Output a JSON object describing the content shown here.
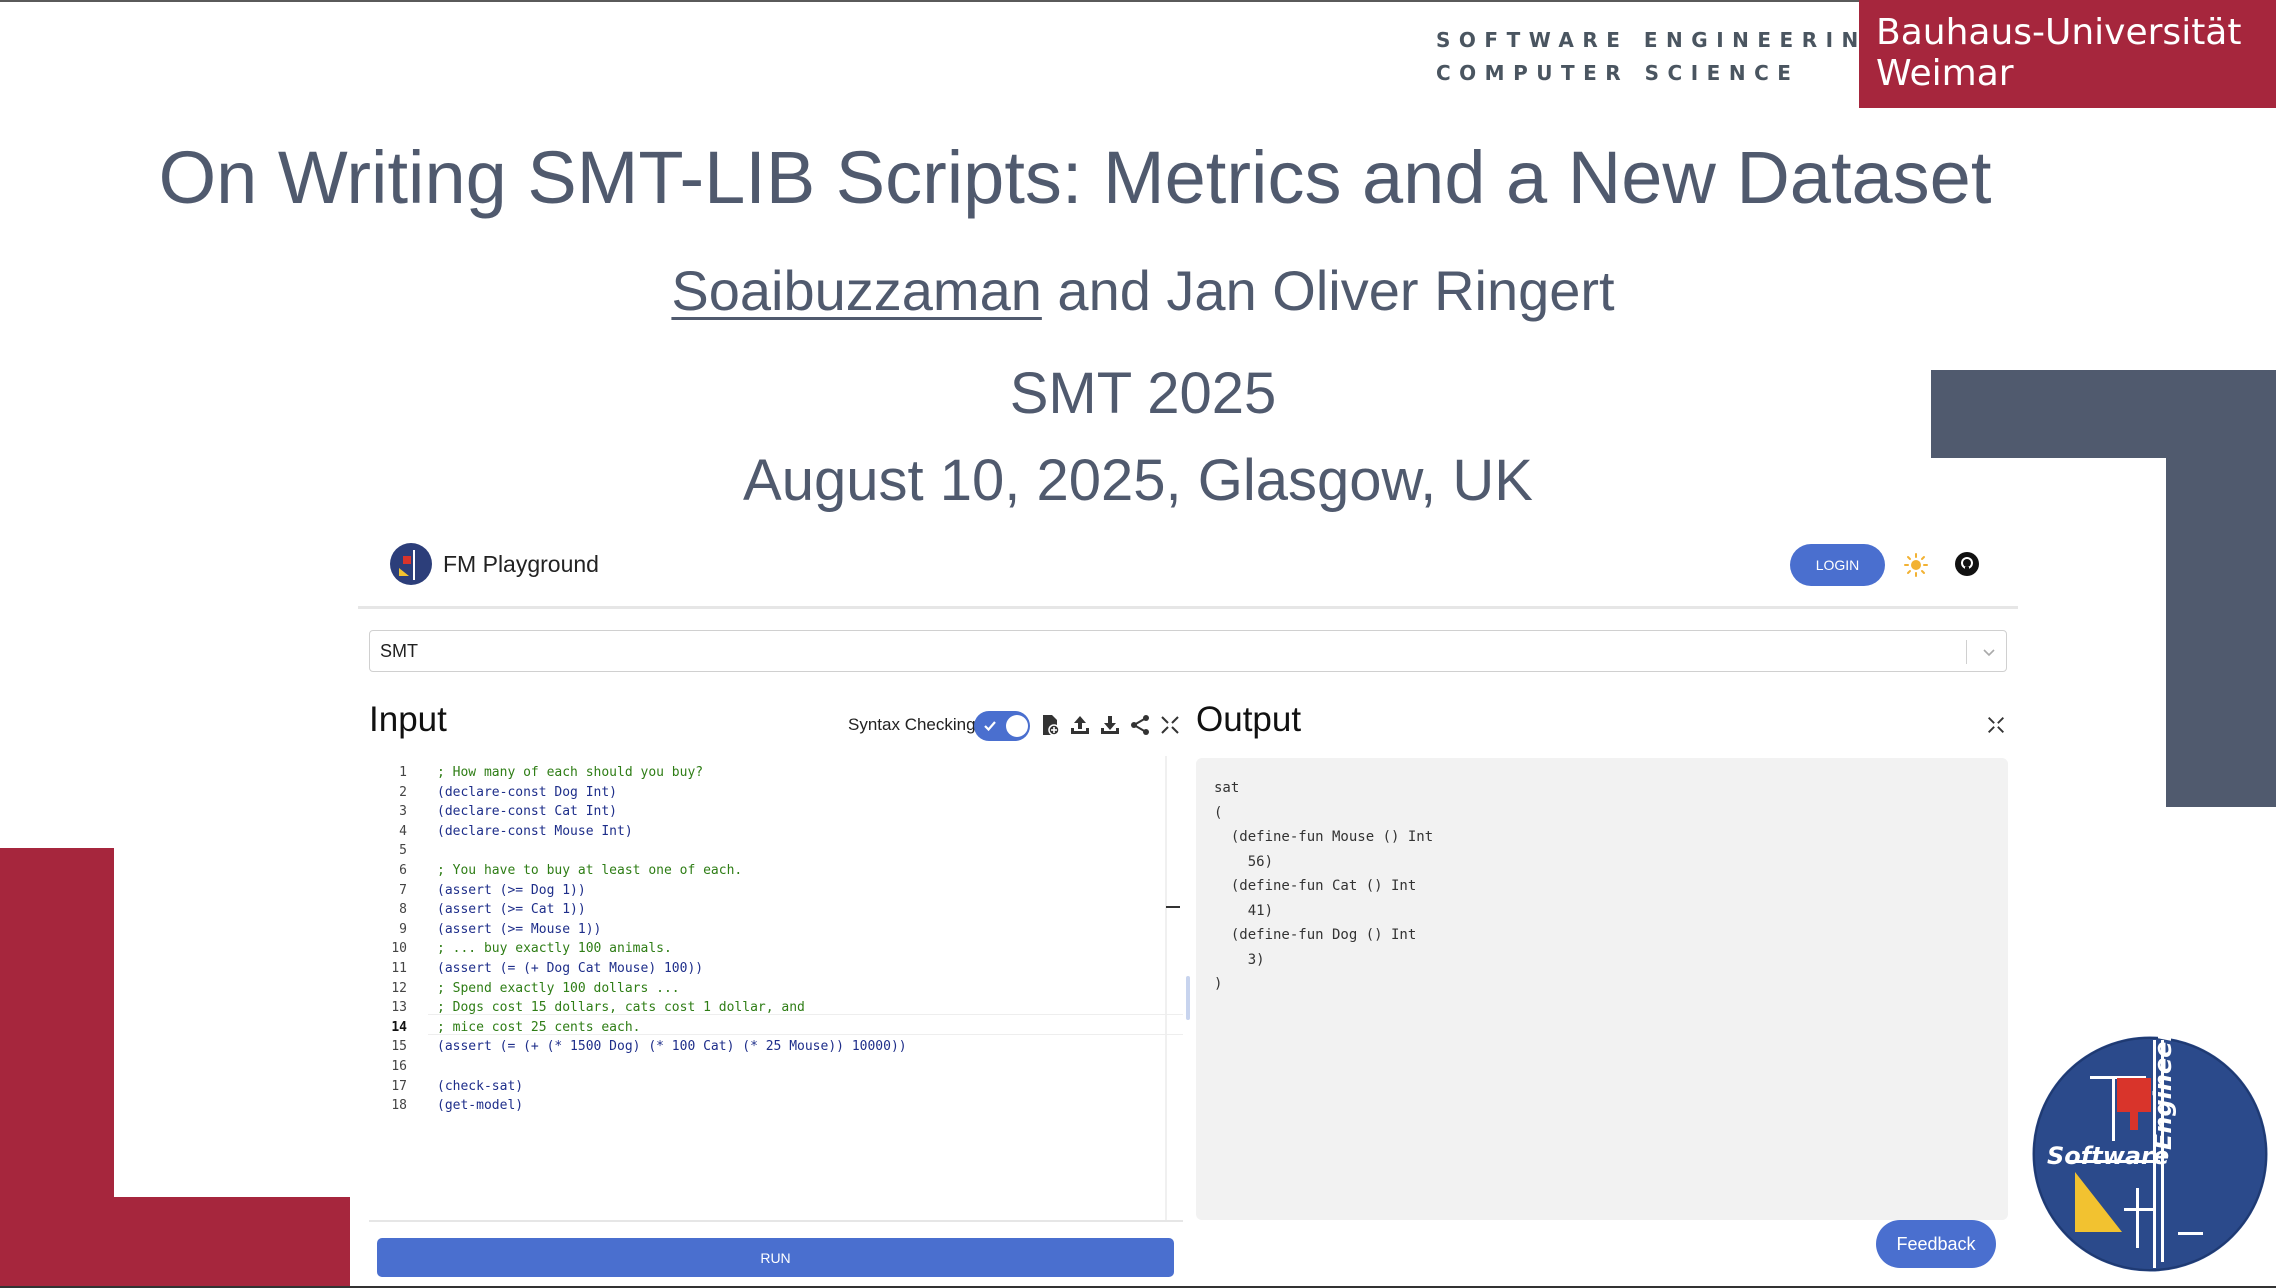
{
  "header": {
    "department_line1": "SOFTWARE ENGINEERING",
    "department_line2": "COMPUTER SCIENCE",
    "university_line1": "Bauhaus-Universität",
    "university_line2": "Weimar"
  },
  "slide": {
    "title": "On Writing SMT-LIB Scripts: Metrics and a New Dataset",
    "author1": "Soaibuzzaman",
    "author_joiner": " and ",
    "author2": "Jan Oliver Ringert",
    "venue": "SMT 2025",
    "date_location": "August 10, 2025, Glasgow, UK"
  },
  "app": {
    "name": "FM Playground",
    "login_label": "LOGIN",
    "theme_icon": "sun-icon",
    "repo_icon": "github-icon",
    "language_selected": "SMT",
    "input_title": "Input",
    "syntax_checking_label": "Syntax Checking",
    "syntax_checking_on": true,
    "output_title": "Output",
    "run_label": "RUN",
    "feedback_label": "Feedback",
    "editor_active_line": 14,
    "editor_lines": [
      {
        "n": "1",
        "text": "; How many of each should you buy?",
        "type": "comment"
      },
      {
        "n": "2",
        "text": "(declare-const Dog Int)",
        "type": "code"
      },
      {
        "n": "3",
        "text": "(declare-const Cat Int)",
        "type": "code"
      },
      {
        "n": "4",
        "text": "(declare-const Mouse Int)",
        "type": "code"
      },
      {
        "n": "5",
        "text": "",
        "type": "code"
      },
      {
        "n": "6",
        "text": "; You have to buy at least one of each.",
        "type": "comment"
      },
      {
        "n": "7",
        "text": "(assert (>= Dog 1))",
        "type": "code"
      },
      {
        "n": "8",
        "text": "(assert (>= Cat 1))",
        "type": "code"
      },
      {
        "n": "9",
        "text": "(assert (>= Mouse 1))",
        "type": "code"
      },
      {
        "n": "10",
        "text": "; ... buy exactly 100 animals.",
        "type": "comment"
      },
      {
        "n": "11",
        "text": "(assert (= (+ Dog Cat Mouse) 100))",
        "type": "code"
      },
      {
        "n": "12",
        "text": "; Spend exactly 100 dollars ...",
        "type": "comment"
      },
      {
        "n": "13",
        "text": "; Dogs cost 15 dollars, cats cost 1 dollar, and",
        "type": "comment"
      },
      {
        "n": "14",
        "text": "; mice cost 25 cents each.",
        "type": "comment"
      },
      {
        "n": "15",
        "text": "(assert (= (+ (* 1500 Dog) (* 100 Cat) (* 25 Mouse)) 10000))",
        "type": "code"
      },
      {
        "n": "16",
        "text": "",
        "type": "code"
      },
      {
        "n": "17",
        "text": "(check-sat)",
        "type": "code"
      },
      {
        "n": "18",
        "text": "(get-model)",
        "type": "code"
      }
    ],
    "output_lines": [
      "sat",
      "(",
      "  (define-fun Mouse () Int",
      "    56)",
      "  (define-fun Cat () Int",
      "    41)",
      "  (define-fun Dog () Int",
      "    3)",
      ")"
    ]
  },
  "logo": {
    "word1": "Software",
    "word2": "Engineering"
  },
  "colors": {
    "accent_red": "#a6263d",
    "slate": "#505a6e",
    "app_blue": "#4a6fcf",
    "comment_green": "#2e7d15",
    "code_blue": "#1e2e8a"
  }
}
